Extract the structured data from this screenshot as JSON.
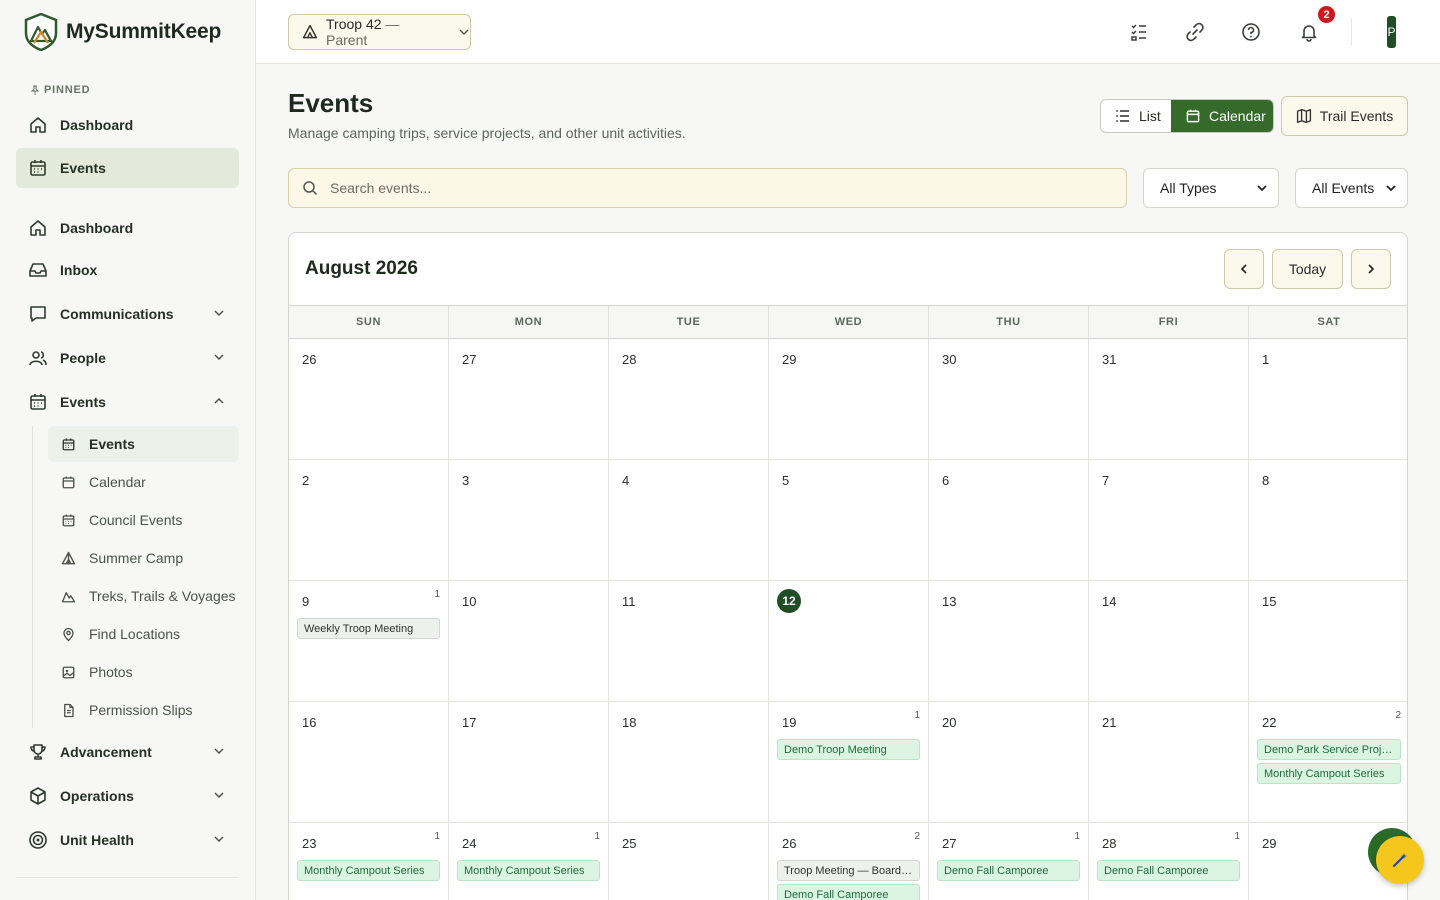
{
  "brand": {
    "name": "MySummitKeep"
  },
  "sidebar": {
    "pinned_label": "PINNED",
    "pinned": [
      {
        "label": "Dashboard",
        "icon": "home-icon"
      },
      {
        "label": "Events",
        "icon": "calendar-icon"
      }
    ],
    "items": [
      {
        "label": "Dashboard",
        "icon": "home-icon"
      },
      {
        "label": "Inbox",
        "icon": "inbox-icon"
      },
      {
        "label": "Communications",
        "icon": "message-icon"
      },
      {
        "label": "People",
        "icon": "people-icon"
      },
      {
        "label": "Events",
        "icon": "calendar-icon"
      },
      {
        "label": "Advancement",
        "icon": "trophy-icon"
      },
      {
        "label": "Operations",
        "icon": "box-icon"
      },
      {
        "label": "Unit Health",
        "icon": "target-icon"
      }
    ],
    "events_sub": [
      {
        "label": "Events",
        "icon": "calendar-icon"
      },
      {
        "label": "Calendar",
        "icon": "calendar-icon"
      },
      {
        "label": "Council Events",
        "icon": "calendar-icon"
      },
      {
        "label": "Summer Camp",
        "icon": "tent-icon"
      },
      {
        "label": "Treks, Trails & Voyages",
        "icon": "mountain-icon"
      },
      {
        "label": "Find Locations",
        "icon": "map-pin-icon"
      },
      {
        "label": "Photos",
        "icon": "image-icon"
      },
      {
        "label": "Permission Slips",
        "icon": "document-icon"
      }
    ]
  },
  "topbar": {
    "unit": "Troop 42",
    "role": "— Parent",
    "notification_count": "2",
    "avatar_initial": "P"
  },
  "page": {
    "title": "Events",
    "subtitle": "Manage camping trips, service projects, and other unit activities.",
    "view_list": "List",
    "view_calendar": "Calendar",
    "trail_events": "Trail Events",
    "search_placeholder": "Search events...",
    "filter_type": "All Types",
    "filter_events": "All Events"
  },
  "calendar": {
    "month_label": "August 2026",
    "today_label": "Today",
    "weekdays": [
      "SUN",
      "MON",
      "TUE",
      "WED",
      "THU",
      "FRI",
      "SAT"
    ],
    "days": [
      {
        "d": "26",
        "n": "",
        "events": []
      },
      {
        "d": "27",
        "n": "",
        "events": []
      },
      {
        "d": "28",
        "n": "",
        "events": []
      },
      {
        "d": "29",
        "n": "",
        "events": []
      },
      {
        "d": "30",
        "n": "",
        "events": []
      },
      {
        "d": "31",
        "n": "",
        "events": []
      },
      {
        "d": "1",
        "n": "",
        "events": []
      },
      {
        "d": "2",
        "n": "",
        "events": []
      },
      {
        "d": "3",
        "n": "",
        "events": []
      },
      {
        "d": "4",
        "n": "",
        "events": []
      },
      {
        "d": "5",
        "n": "",
        "events": []
      },
      {
        "d": "6",
        "n": "",
        "events": []
      },
      {
        "d": "7",
        "n": "",
        "events": []
      },
      {
        "d": "8",
        "n": "",
        "events": []
      },
      {
        "d": "9",
        "n": "1",
        "events": [
          {
            "title": "Weekly Troop Meeting",
            "style": "gray"
          }
        ]
      },
      {
        "d": "10",
        "n": "",
        "events": []
      },
      {
        "d": "11",
        "n": "",
        "events": []
      },
      {
        "d": "12",
        "n": "",
        "today": true,
        "events": []
      },
      {
        "d": "13",
        "n": "",
        "events": []
      },
      {
        "d": "14",
        "n": "",
        "events": []
      },
      {
        "d": "15",
        "n": "",
        "events": []
      },
      {
        "d": "16",
        "n": "",
        "events": []
      },
      {
        "d": "17",
        "n": "",
        "events": []
      },
      {
        "d": "18",
        "n": "",
        "events": []
      },
      {
        "d": "19",
        "n": "1",
        "events": [
          {
            "title": "Demo Troop Meeting",
            "style": "green"
          }
        ]
      },
      {
        "d": "20",
        "n": "",
        "events": []
      },
      {
        "d": "21",
        "n": "",
        "events": []
      },
      {
        "d": "22",
        "n": "2",
        "events": [
          {
            "title": "Demo Park Service Project",
            "style": "green"
          },
          {
            "title": "Monthly Campout Series",
            "style": "green"
          }
        ]
      },
      {
        "d": "23",
        "n": "1",
        "events": [
          {
            "title": "Monthly Campout Series",
            "style": "green"
          }
        ]
      },
      {
        "d": "24",
        "n": "1",
        "events": [
          {
            "title": "Monthly Campout Series",
            "style": "green"
          }
        ]
      },
      {
        "d": "25",
        "n": "",
        "events": []
      },
      {
        "d": "26",
        "n": "2",
        "events": [
          {
            "title": "Troop Meeting — Board of Review",
            "style": "gray"
          },
          {
            "title": "Demo Fall Camporee",
            "style": "green"
          }
        ]
      },
      {
        "d": "27",
        "n": "1",
        "events": [
          {
            "title": "Demo Fall Camporee",
            "style": "green"
          }
        ]
      },
      {
        "d": "28",
        "n": "1",
        "events": [
          {
            "title": "Demo Fall Camporee",
            "style": "green"
          }
        ]
      },
      {
        "d": "29",
        "n": "",
        "events": []
      }
    ]
  },
  "colors": {
    "primary": "#356a2b",
    "today": "#1f4d24",
    "accent_yellow": "#f5c61c",
    "badge": "#d4151c"
  }
}
